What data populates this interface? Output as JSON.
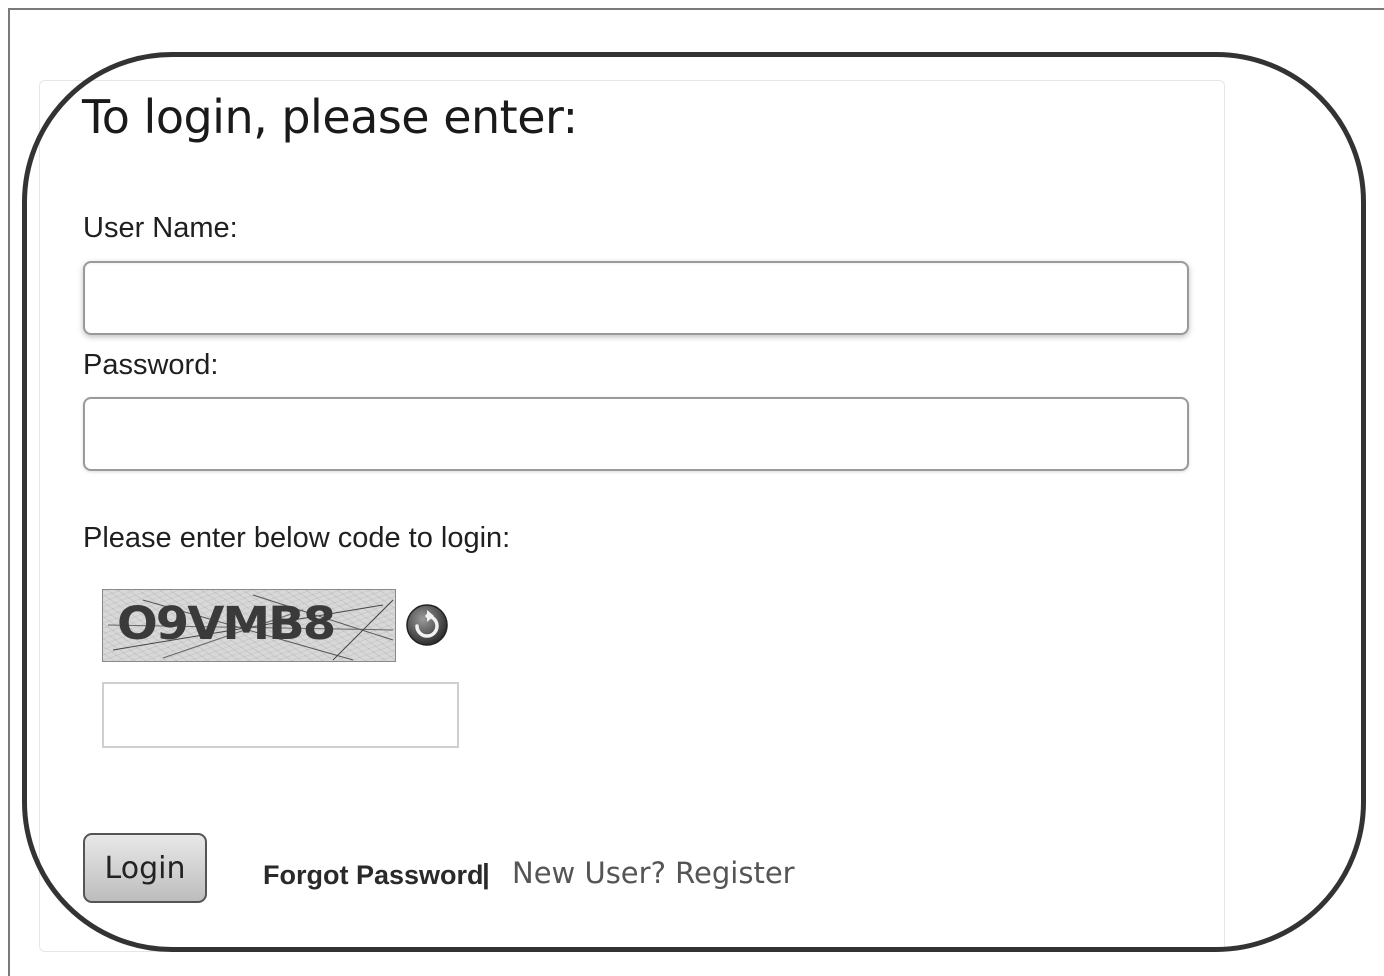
{
  "login": {
    "heading": "To login, please enter:",
    "username_label": "User Name:",
    "username_value": "",
    "password_label": "Password:",
    "password_value": "",
    "captcha_label": "Please enter below code to login:",
    "captcha_code": "O9VMB8",
    "captcha_value": "",
    "refresh_icon": "refresh-icon",
    "login_button": "Login",
    "forgot_password": "Forgot Password",
    "separator": "|",
    "register": "New User? Register"
  }
}
